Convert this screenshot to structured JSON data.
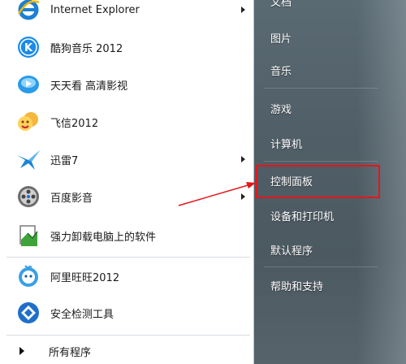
{
  "left_menu": {
    "items": [
      {
        "label": "Internet Explorer",
        "icon": "ie-icon",
        "has_submenu": true
      },
      {
        "label": "酷狗音乐 2012",
        "icon": "kugou-icon",
        "has_submenu": false
      },
      {
        "label": "天天看 高清影视",
        "icon": "tiantiankan-icon",
        "has_submenu": false
      },
      {
        "label": "飞信2012",
        "icon": "fetion-icon",
        "has_submenu": false
      },
      {
        "label": "迅雷7",
        "icon": "xunlei-icon",
        "has_submenu": true
      },
      {
        "label": "百度影音",
        "icon": "baidu-player-icon",
        "has_submenu": true
      },
      {
        "label": "强力卸载电脑上的软件",
        "icon": "uninstaller-icon",
        "has_submenu": false
      },
      {
        "label": "阿里旺旺2012",
        "icon": "aliwangwang-icon",
        "has_submenu": false
      },
      {
        "label": "安全检测工具",
        "icon": "security-scan-icon",
        "has_submenu": false
      }
    ],
    "all_programs": "所有程序"
  },
  "right_menu": {
    "items": [
      {
        "label": "文档"
      },
      {
        "label": "图片"
      },
      {
        "label": "音乐"
      },
      {
        "label": "游戏"
      },
      {
        "label": "计算机"
      },
      {
        "label": "控制面板"
      },
      {
        "label": "设备和打印机"
      },
      {
        "label": "默认程序"
      },
      {
        "label": "帮助和支持"
      }
    ]
  },
  "annotation": {
    "highlight_color": "#e5161b",
    "highlighted_item": "控制面板"
  }
}
